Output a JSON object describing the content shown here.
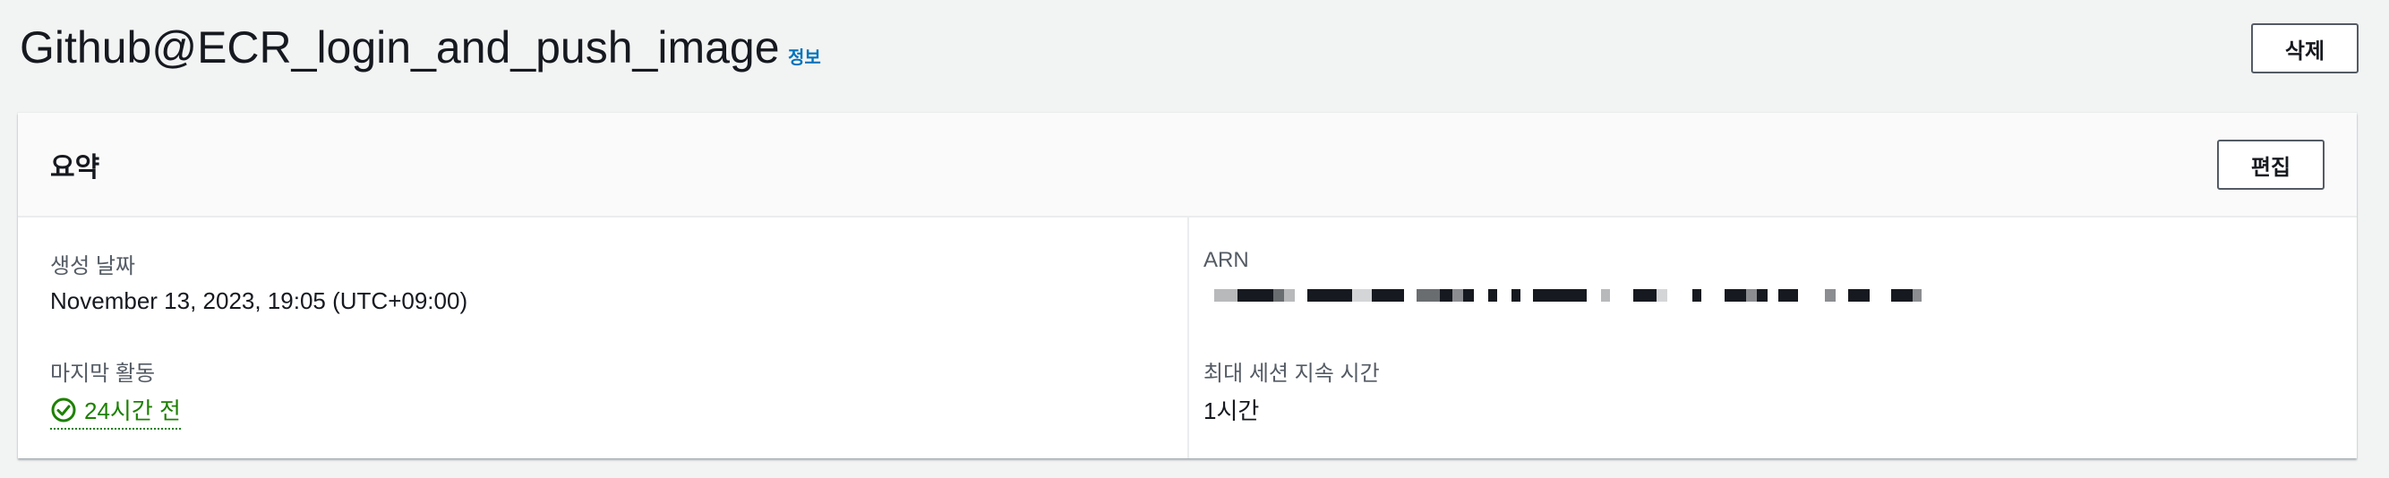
{
  "header": {
    "title": "Github@ECR_login_and_push_image",
    "info_link": "정보",
    "delete_label": "삭제"
  },
  "summary": {
    "title": "요약",
    "edit_label": "편집",
    "created": {
      "label": "생성 날짜",
      "value": "November 13, 2023, 19:05 (UTC+09:00)"
    },
    "last_activity": {
      "label": "마지막 활동",
      "value": "24시간 전"
    },
    "arn": {
      "label": "ARN",
      "value_redacted": true
    },
    "max_session": {
      "label": "최대 세션 지속 시간",
      "value": "1시간"
    }
  },
  "colors": {
    "background": "#f2f3f3",
    "link": "#0073bb",
    "success": "#1d8102",
    "text": "#16191f",
    "muted": "#545b64"
  },
  "icons": {
    "status": "check-circle-icon"
  }
}
